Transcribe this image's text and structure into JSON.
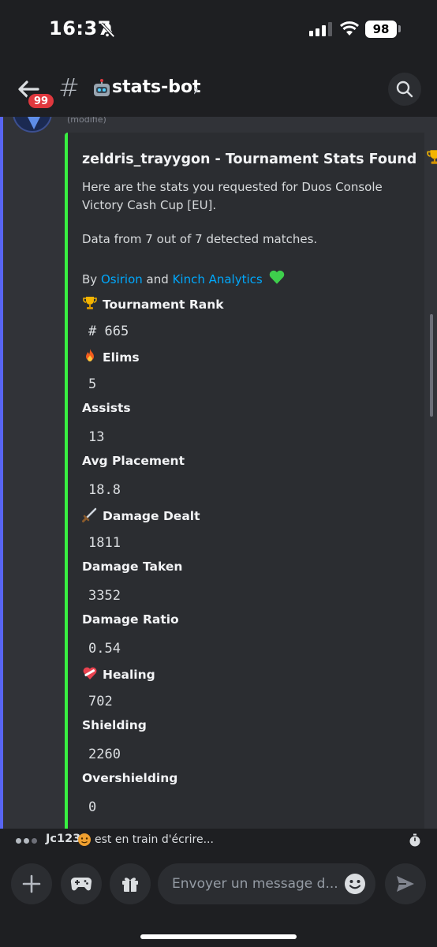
{
  "status_bar": {
    "time": "16:37",
    "battery": "98"
  },
  "header": {
    "badge": "99",
    "hash": "#",
    "channel_name": "stats-bot",
    "chevron": "›"
  },
  "message": {
    "edited_label": "(modifié)",
    "embed": {
      "title": "zeldris_trayygon - Tournament Stats Found",
      "description": "Here are the stats you requested for Duos Console Victory Cash Cup  [EU].",
      "matches_text": "Data from 7 out of 7 detected matches.",
      "by_prefix": "By",
      "by_link1": "Osirion",
      "by_and": "and",
      "by_link2": "Kinch Analytics",
      "fields": [
        {
          "name": "Tournament Rank",
          "value": "# 665",
          "icon": "trophy-icon"
        },
        {
          "name": "Elims",
          "value": "5",
          "icon": "fire-icon"
        },
        {
          "name": "Assists",
          "value": "13",
          "icon": ""
        },
        {
          "name": "Avg Placement",
          "value": "18.8",
          "icon": ""
        },
        {
          "name": "Damage Dealt",
          "value": "1811",
          "icon": "dagger-icon"
        },
        {
          "name": "Damage Taken",
          "value": "3352",
          "icon": ""
        },
        {
          "name": "Damage Ratio",
          "value": "0.54",
          "icon": ""
        },
        {
          "name": "Healing",
          "value": "702",
          "icon": "mending-heart-icon"
        },
        {
          "name": "Shielding",
          "value": "2260",
          "icon": ""
        },
        {
          "name": "Overshielding",
          "value": "0",
          "icon": ""
        }
      ]
    }
  },
  "typing": {
    "user": "Jc123",
    "text": "est en train d'écrire..."
  },
  "composer": {
    "placeholder": "Envoyer un message d..."
  },
  "colors": {
    "accent": "#5865f2",
    "embed_border": "#38f041",
    "link": "#00a8fc",
    "badge": "#e0383e"
  }
}
